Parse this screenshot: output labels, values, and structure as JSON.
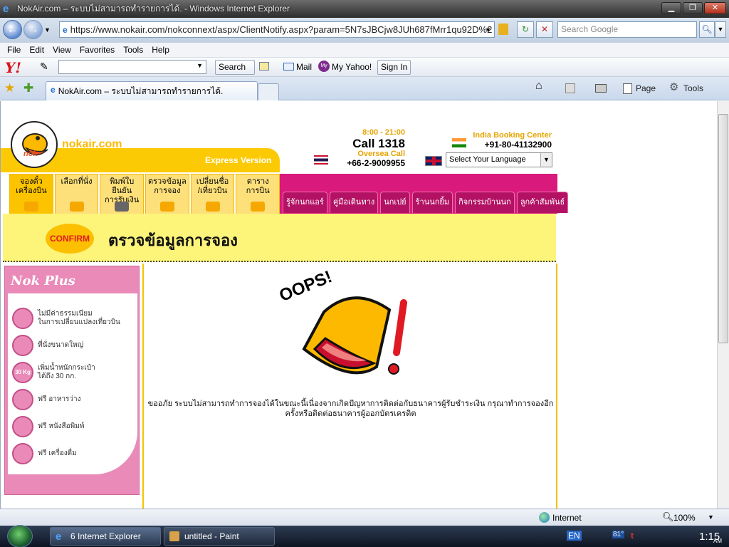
{
  "window": {
    "title": "NokAir.com – ระบบไม่สามารถทำรายการได้. - Windows Internet Explorer"
  },
  "address": {
    "url": "https://www.nokair.com/nokconnext/aspx/ClientNotify.aspx?param=5N7sJBCjw8JUh687fMrr1qu92D%2",
    "search_placeholder": "Search Google"
  },
  "menu": {
    "items": [
      "File",
      "Edit",
      "View",
      "Favorites",
      "Tools",
      "Help"
    ]
  },
  "yahoo_toolbar": {
    "search_label": "Search",
    "mail_label": "Mail",
    "my_yahoo_label": "My Yahoo!",
    "signin_label": "Sign In"
  },
  "tabs": {
    "active_tab_label": "NokAir.com – ระบบไม่สามารถทำรายการได้."
  },
  "commandbar": {
    "page_label": "Page",
    "tools_label": "Tools"
  },
  "nok": {
    "brand": "nokair.com",
    "logo_text": "nok",
    "express": "Express Version",
    "hours": "8:00 - 21:00",
    "call": "Call 1318",
    "oversea_label": "Oversea Call",
    "oversea_number": "+66-2-9009955",
    "india_label": "India Booking Center",
    "india_number": "+91-80-41132900",
    "language_select": "Select Your Language",
    "nav_tabs": [
      {
        "label": "จองตั๋ว\nเครื่องบิน"
      },
      {
        "label": "เลือกที่นั่ง"
      },
      {
        "label": "พิมพ์ใบยืนยัน\nการรับเงิน"
      },
      {
        "label": "ตรวจข้อมูล\nการจอง"
      },
      {
        "label": "เปลี่ยนชื่อ\n/เที่ยวบิน"
      },
      {
        "label": "ตาราง\nการบิน"
      }
    ],
    "pink_tabs": [
      "รู้จักนกแอร์",
      "คู่มือเดินทาง",
      "นกเปย์",
      "ร้านนกยิ้ม",
      "กิจกรรมบ้านนก",
      "ลูกค้าสัมพันธ์"
    ],
    "confirm_badge": "CONFIRM",
    "banner_title": "ตรวจข้อมูลการจอง",
    "nokplus": {
      "title": "Nok Plus",
      "items": [
        {
          "text": "ไม่มีค่าธรรมเนียม\nในการเปลี่ยนแปลงเที่ยวบิน"
        },
        {
          "text": "ที่นั่งขนาดใหญ่"
        },
        {
          "text": "เพิ่มน้ำหนักกระเป๋า\nได้ถึง 30 กก."
        },
        {
          "text": "ฟรี อาหารว่าง"
        },
        {
          "text": "ฟรี หนังสือพิมพ์"
        },
        {
          "text": "ฟรี เครื่องดื่ม"
        }
      ],
      "baggage_badge": "30 Kg"
    },
    "oops": "OOPS!",
    "error_line1": "ขออภัย ระบบไม่สามารถทำการจองได้ในขณะนี้เนื่องจากเกิดปัญหาการติดต่อกับธนาคารผู้รับชำระเงิน กรุณาทำการจองอีก",
    "error_line2": "ครั้งหรือติดต่อธนาคารผู้ออกบัตรเครดิต"
  },
  "statusbar": {
    "zone": "Internet",
    "zoom": "100%"
  },
  "taskbar": {
    "ie_button": "6 Internet Explorer",
    "paint_button": "untitled - Paint",
    "lang": "EN",
    "temp": "81°",
    "clock": "1:15",
    "ampm": "AM"
  }
}
